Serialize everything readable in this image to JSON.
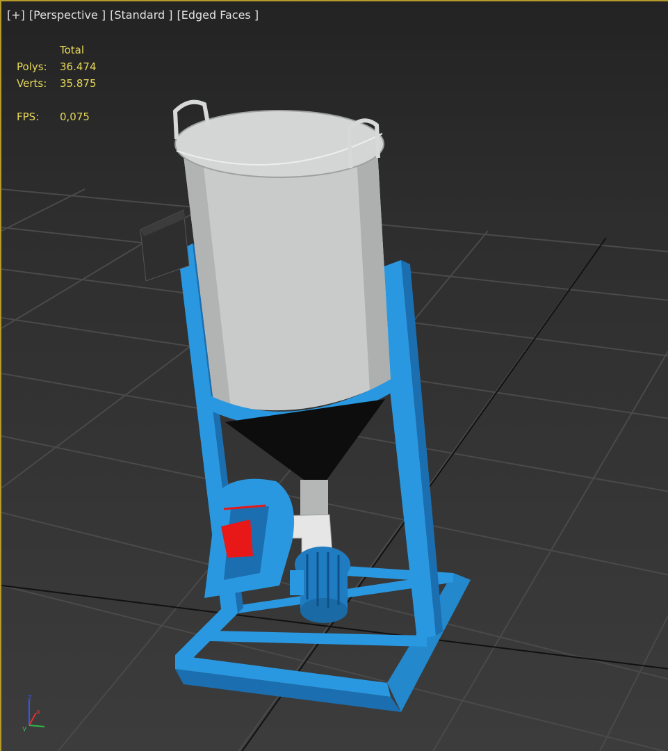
{
  "viewport": {
    "menu": {
      "plus": "[+]",
      "view": "[Perspective ]",
      "shading": "[Standard ]",
      "edges": "[Edged Faces ]"
    },
    "stats": {
      "header": "Total",
      "polys_label": "Polys:",
      "polys_value": "36.474",
      "verts_label": "Verts:",
      "verts_value": "35.875",
      "fps_label": "FPS:",
      "fps_value": "0,075"
    },
    "axis_gizmo": {
      "x": "x",
      "y": "y",
      "z": "z"
    }
  },
  "colors": {
    "frame": "#2a98e0",
    "tank": "#c9cbcb",
    "cone": "#0d0d0d",
    "motor": "#1f7cc0",
    "accent_red": "#e81818",
    "viewport_border": "#b69a2a",
    "stats_text": "#e7d85a"
  }
}
